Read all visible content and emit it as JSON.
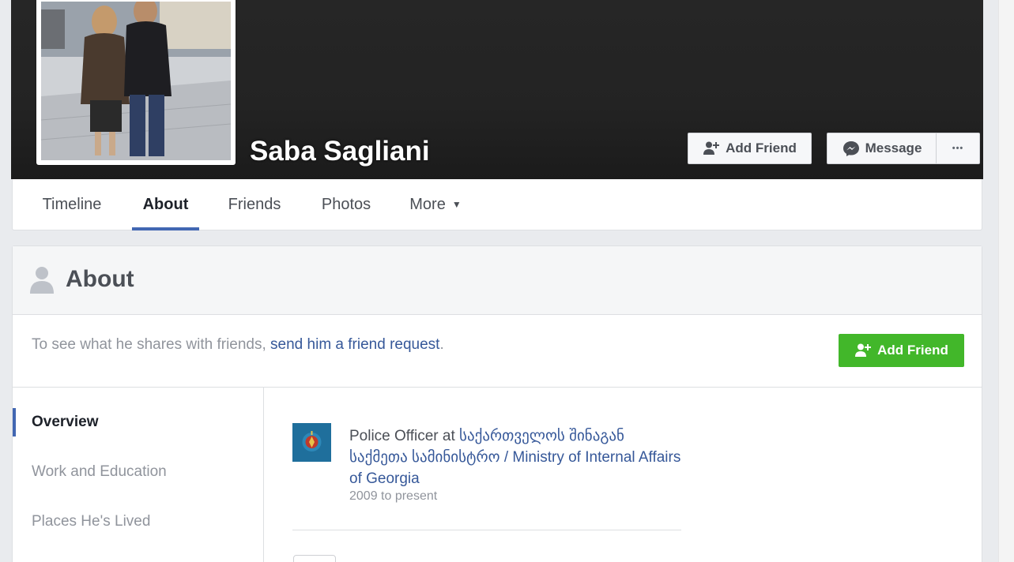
{
  "profile": {
    "name": "Saba Sagliani"
  },
  "cover_actions": {
    "add_friend_label": "Add Friend",
    "message_label": "Message",
    "more_label": "•••"
  },
  "nav": {
    "tabs": [
      {
        "label": "Timeline",
        "active": false
      },
      {
        "label": "About",
        "active": true
      },
      {
        "label": "Friends",
        "active": false
      },
      {
        "label": "Photos",
        "active": false
      },
      {
        "label": "More",
        "active": false
      }
    ],
    "more_caret": "▼"
  },
  "about": {
    "title": "About",
    "notice_prefix": "To see what he shares with friends, ",
    "notice_link": "send him a friend request",
    "notice_suffix": ".",
    "add_friend_label": "Add Friend"
  },
  "sidebar": {
    "items": [
      {
        "label": "Overview",
        "active": true
      },
      {
        "label": "Work and Education",
        "active": false
      },
      {
        "label": "Places He's Lived",
        "active": false
      }
    ]
  },
  "work": {
    "role_prefix": "Police Officer at ",
    "employer": "საქართველოს შინაგან საქმეთა სამინისტრო / Ministry of Internal Affairs of Georgia",
    "period": "2009 to present"
  },
  "colors": {
    "accent_blue": "#4267b2",
    "link_blue": "#365899",
    "green": "#42b72a",
    "cover": "#232323"
  }
}
